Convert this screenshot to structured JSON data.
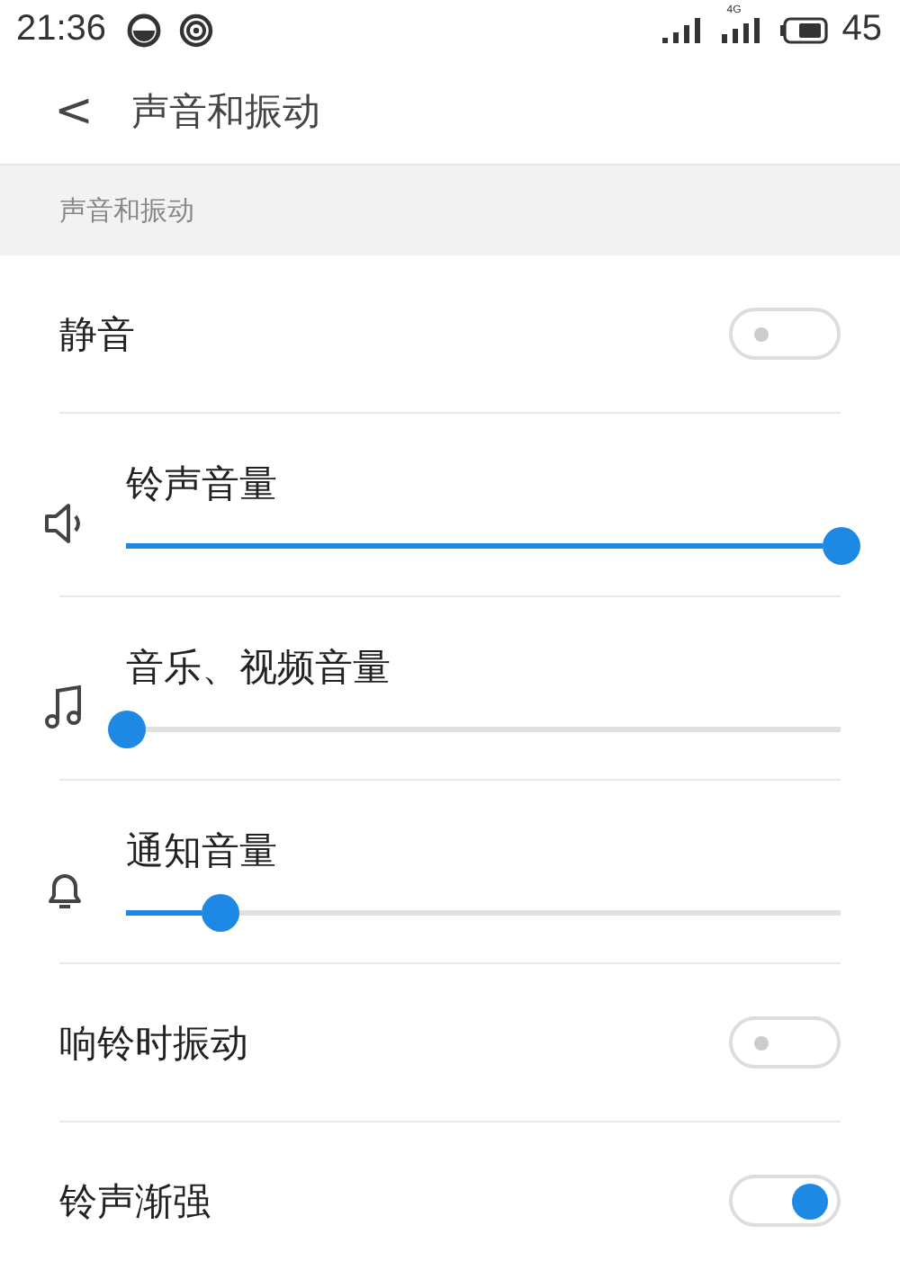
{
  "status_bar": {
    "time": "21:36",
    "network": "4G",
    "battery": "45"
  },
  "header": {
    "back": "<",
    "title": "声音和振动"
  },
  "section": {
    "label": "声音和振动"
  },
  "items": [
    {
      "kind": "toggle",
      "label": "静音",
      "on": false
    },
    {
      "kind": "slider",
      "label": "铃声音量",
      "level": 1.0
    },
    {
      "kind": "slider",
      "label": "音乐、视频音量",
      "level": 0.0
    },
    {
      "kind": "slider",
      "label": "通知音量",
      "level": 0.13
    },
    {
      "kind": "toggle",
      "label": "响铃时振动",
      "on": false
    },
    {
      "kind": "toggle",
      "label": "铃声渐强",
      "on": true
    }
  ]
}
